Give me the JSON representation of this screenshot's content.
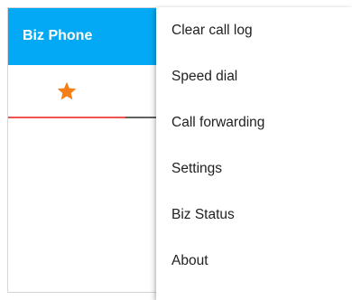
{
  "app_bar": {
    "title": "Biz Phone",
    "color": "#03a9f4"
  },
  "tabs": {
    "active_tab_icon": "star-icon",
    "star_color": "#f57f17",
    "indicator_color": "#ef5350"
  },
  "overflow_menu": {
    "items": [
      {
        "label": "Clear call log"
      },
      {
        "label": "Speed dial"
      },
      {
        "label": "Call forwarding"
      },
      {
        "label": "Settings"
      },
      {
        "label": "Biz Status"
      },
      {
        "label": "About"
      }
    ]
  }
}
